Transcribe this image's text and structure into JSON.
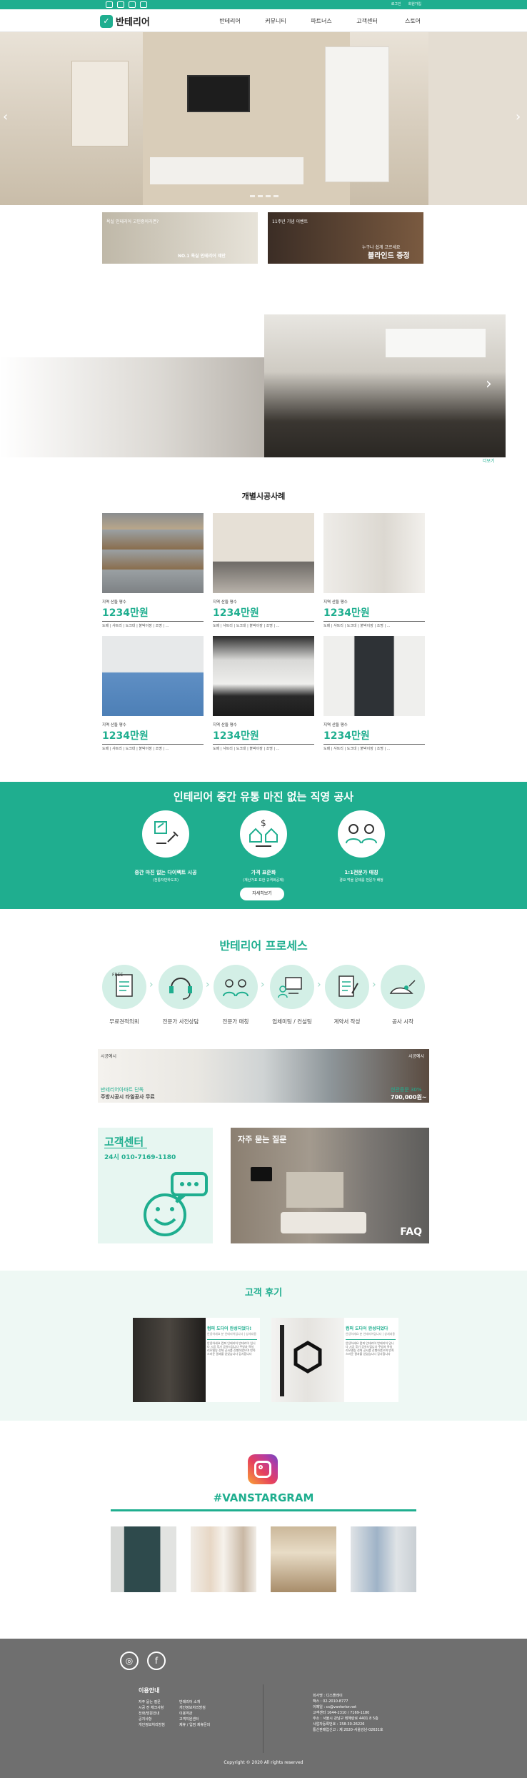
{
  "topbar": {
    "links": [
      "로그인",
      "회원가입"
    ]
  },
  "header": {
    "logo_text": "반테리어",
    "nav": [
      "반테리어",
      "커뮤니티",
      "파트너스",
      "고객센터",
      "스토어"
    ]
  },
  "banners": [
    {
      "small": "욕실 인테리어 고민중이라면?",
      "big": "NO.1 욕실 인테리어 제안"
    },
    {
      "small": "11주년 기념 이벤트",
      "small2": "누구나 쉽게 고르세요",
      "big": "블라인드 증정"
    }
  ],
  "mid": {
    "more": "더보기"
  },
  "gallery": {
    "title": "개별시공사례",
    "cards": [
      {
        "cap": "지역 산들 평수",
        "price": "1234만원",
        "meta": "도배 | 샤트리 | 도크대 | 붙박이장 | 조명 | ..."
      },
      {
        "cap": "지역 산들 평수",
        "price": "1234만원",
        "meta": "도배 | 샤트리 | 도크대 | 붙박이장 | 조명 | ..."
      },
      {
        "cap": "지역 산들 평수",
        "price": "1234만원",
        "meta": "도배 | 샤트리 | 도크대 | 붙박이장 | 조명 | ..."
      },
      {
        "cap": "지역 산들 평수",
        "price": "1234만원",
        "meta": "도배 | 샤트리 | 도크대 | 붙박이장 | 조명 | ..."
      },
      {
        "cap": "지역 산들 평수",
        "price": "1234만원",
        "meta": "도배 | 샤트리 | 도크대 | 붙박이장 | 조명 | ..."
      },
      {
        "cap": "지역 산들 평수",
        "price": "1234만원",
        "meta": "도배 | 샤트리 | 도크대 | 붙박이장 | 조명 | ..."
      }
    ]
  },
  "teal": {
    "title": "인테리어 중간 유통 마진 없는 직영 공사",
    "features": [
      {
        "t1": "중간 마진 없는 다이렉트 시공",
        "t2": "(전통자반하도조)"
      },
      {
        "t1": "가격 표준화",
        "t2": "(계산가표 표한 규격화공제)"
      },
      {
        "t1": "1:1전문가 매칭",
        "t2": "경요 먹을 문제를 전문가 배정"
      }
    ],
    "button": "자세히보기"
  },
  "process": {
    "title": "반테리어 프로세스",
    "steps": [
      "무료견적의뢰",
      "전문가 사전상담",
      "전문가 매칭",
      "업체미팅 / 컨설팅",
      "계약서 작성",
      "공사 시작"
    ]
  },
  "promo": {
    "tag_left": "시공예시",
    "line1": "반테리어아파트 단독",
    "line2": "주방시공시 타일공사 무료",
    "tag_right": "시공예시",
    "sale": "현관중문 30%",
    "price": "700,000원~"
  },
  "cs": {
    "title": "고객센터",
    "phone": "24시 010-7169-1180"
  },
  "faq": {
    "title": "자주 묻는 질문",
    "badge": "FAQ"
  },
  "reviews": {
    "title": "고객 후기",
    "items": [
      {
        "title": "컴퍼 도다어 완성되었다!",
        "sub": "안녕하세요 분 인테리어입니다 | 상세내용",
        "body": "안녕하세요 컴퍼 인테리어 반테리어 입니다 시공 후기 공유드립니다 주방과 욕실 리모델링 전체 공사를 진행하였으며 만족스러운 결과를 얻었습니다 감사합니다"
      },
      {
        "title": "컴퍼 도다어 완성되었다",
        "sub": "안녕하세요 분 인테리어입니다 | 상세내용",
        "body": "안녕하세요 컴퍼 인테리어 반테리어 입니다 시공 후기 공유드립니다 주방과 욕실 리모델링 전체 공사를 진행하였으며 만족스러운 결과를 얻었습니다 감사합니다"
      }
    ]
  },
  "instagram": {
    "title": "#VANSTARGRAM"
  },
  "footer": {
    "title": "이용안내",
    "col1": [
      "자주 묻는 질문",
      "시공 전 체크사항",
      "전화/방문안내",
      "공지사항",
      "개인정보처리방침"
    ],
    "col2": [
      "반테리어 소개",
      "개인정보처리방침",
      "이용약관",
      "고객지원센터",
      "제휴 / 입점 제휴문의"
    ],
    "info": [
      "회사명 : 디스플레이",
      "팩스 : 02-2010-8777",
      "이메일 : cs@vanterior.net",
      "고객센터 1644-2310 / 7169-1180",
      "주소 : 서울시 강남구 테헤란로 4401 8 5층",
      "사업자등록번호 : 158-30-26226",
      "통신판매업신고 : 제 2020-서울강남-02631호"
    ],
    "copyright": "Copyright © 2020 All rights reserved"
  }
}
